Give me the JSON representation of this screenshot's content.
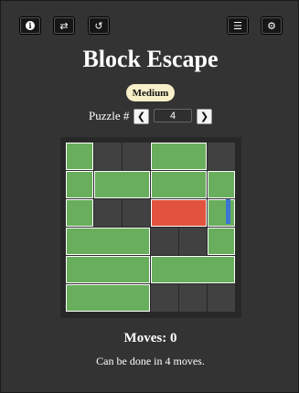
{
  "toolbar": {
    "info_icon": "info-icon",
    "shuffle_icon": "shuffle-icon",
    "undo_icon": "undo-icon",
    "list_icon": "list-icon",
    "settings_icon": "gear-icon"
  },
  "title": "Block Escape",
  "difficulty": "Medium",
  "puzzle": {
    "label": "Puzzle #",
    "number": "4",
    "prev_icon": "chevron-left-icon",
    "next_icon": "chevron-right-icon"
  },
  "board": {
    "grid_size": [
      6,
      6
    ],
    "exit": {
      "row": 2,
      "side": "right"
    },
    "blocks": [
      {
        "id": "b1",
        "col": 0,
        "row": 0,
        "w": 1,
        "h": 1,
        "type": "normal"
      },
      {
        "id": "b2",
        "col": 3,
        "row": 0,
        "w": 2,
        "h": 1,
        "type": "normal"
      },
      {
        "id": "b3",
        "col": 0,
        "row": 1,
        "w": 1,
        "h": 1,
        "type": "normal"
      },
      {
        "id": "b4",
        "col": 1,
        "row": 1,
        "w": 2,
        "h": 1,
        "type": "normal"
      },
      {
        "id": "b5",
        "col": 3,
        "row": 1,
        "w": 2,
        "h": 1,
        "type": "normal"
      },
      {
        "id": "b6",
        "col": 5,
        "row": 1,
        "w": 1,
        "h": 1,
        "type": "normal"
      },
      {
        "id": "b7",
        "col": 0,
        "row": 2,
        "w": 1,
        "h": 1,
        "type": "normal"
      },
      {
        "id": "target",
        "col": 3,
        "row": 2,
        "w": 2,
        "h": 1,
        "type": "target"
      },
      {
        "id": "b8",
        "col": 5,
        "row": 2,
        "w": 1,
        "h": 1,
        "type": "normal"
      },
      {
        "id": "b9",
        "col": 0,
        "row": 3,
        "w": 3,
        "h": 1,
        "type": "normal"
      },
      {
        "id": "b10",
        "col": 5,
        "row": 3,
        "w": 1,
        "h": 1,
        "type": "normal"
      },
      {
        "id": "b11",
        "col": 0,
        "row": 4,
        "w": 3,
        "h": 1,
        "type": "normal"
      },
      {
        "id": "b12",
        "col": 3,
        "row": 4,
        "w": 3,
        "h": 1,
        "type": "normal"
      },
      {
        "id": "b13",
        "col": 0,
        "row": 5,
        "w": 3,
        "h": 1,
        "type": "normal"
      }
    ]
  },
  "colors": {
    "background": "#333333",
    "block": "#69ae5d",
    "target_block": "#e2533d",
    "exit": "#3c74d1",
    "difficulty_badge": "#f8f0c8"
  },
  "moves": "Moves: 0",
  "hint": "Can be done in 4 moves."
}
